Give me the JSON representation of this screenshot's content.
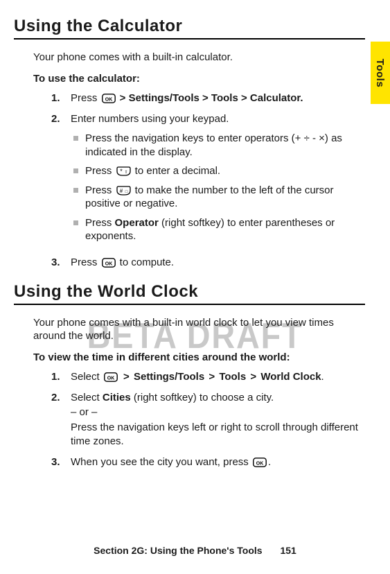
{
  "sideTab": {
    "label": "Tools"
  },
  "watermark": "BETA DRAFT",
  "footer": {
    "section": "Section 2G: Using the Phone's Tools",
    "page": "151"
  },
  "calc": {
    "heading": "Using the Calculator",
    "intro": "Your phone comes with a built-in calculator.",
    "procHead": "To use the calculator:",
    "steps": {
      "s1": {
        "n": "1.",
        "pre": "Press ",
        "trail": " > Settings/Tools > Tools > Calculator."
      },
      "s2": {
        "n": "2.",
        "line": "Enter numbers using your keypad.",
        "b1": "Press the navigation keys to enter operators (+ ÷ - ×) as indicated in the display.",
        "b2pre": "Press ",
        "b2post": " to enter a decimal.",
        "b3pre": "Press ",
        "b3post": " to make the number to the left of the cursor positive or negative.",
        "b4pre": "Press ",
        "b4bold": "Operator",
        "b4post": " (right softkey) to enter parentheses or exponents."
      },
      "s3": {
        "n": "3.",
        "pre": "Press ",
        "post": " to compute."
      }
    }
  },
  "world": {
    "heading": "Using the World Clock",
    "intro": "Your phone comes with a built-in world clock to let you view times around the world.",
    "procHead": "To view the time in different cities around the world:",
    "steps": {
      "s1": {
        "n": "1.",
        "pre": "Select ",
        "sep1": " > ",
        "p1": "Settings/Tools",
        "sep2": " > ",
        "p2": "Tools",
        "sep3": " > ",
        "p3": "World Clock",
        "end": "."
      },
      "s2": {
        "n": "2.",
        "pre": "Select ",
        "bold": "Cities",
        "post": " (right softkey) to choose a city.",
        "or": "– or –",
        "alt": "Press the navigation keys left or right to scroll through different time zones."
      },
      "s3": {
        "n": "3.",
        "pre": "When you see the city you want, press ",
        "post": "."
      }
    }
  }
}
